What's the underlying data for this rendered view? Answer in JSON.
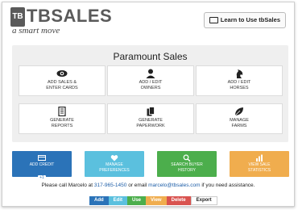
{
  "header": {
    "logo_mark": "TB",
    "logo_text": "TBSALES",
    "tagline": "a smart move",
    "learn_button": "Learn to Use tbSales"
  },
  "panel": {
    "title": "Paramount Sales",
    "tiles": [
      {
        "line1": "ADD SALES &",
        "line2": "ENTER CARDS",
        "icon": "eye-icon"
      },
      {
        "line1": "ADD / EDIT",
        "line2": "OWNERS",
        "icon": "user-icon"
      },
      {
        "line1": "ADD / EDIT",
        "line2": "HORSES",
        "icon": "horse-icon"
      },
      {
        "line1": "GENERATE",
        "line2": "REPORTS",
        "icon": "report-icon"
      },
      {
        "line1": "GENERATE",
        "line2": "PAPERWORK",
        "icon": "paperwork-icon"
      },
      {
        "line1": "MANAGE",
        "line2": "FARMS",
        "icon": "leaf-icon"
      }
    ]
  },
  "actions": [
    {
      "line1": "ADD CREDIT",
      "line2": "",
      "badge": "+1",
      "color": "#2b73b8",
      "icon": "credit-card-icon"
    },
    {
      "line1": "MANAGE",
      "line2": "PREFERENCES",
      "badge": "",
      "color": "#5bc0de",
      "icon": "heart-icon"
    },
    {
      "line1": "SEARCH BUYER",
      "line2": "HISTORY",
      "badge": "",
      "color": "#4cae4c",
      "icon": "search-icon"
    },
    {
      "line1": "VIEW SALE",
      "line2": "STATISTICS",
      "badge": "",
      "color": "#f0ad4e",
      "icon": "statistics-icon"
    }
  ],
  "contact": {
    "prefix": "Please call Marcelo at",
    "phone": "317-965-1450",
    "middle": "or email",
    "email": "marcelo@tbsales.com",
    "suffix": "if you need assistance."
  },
  "bottom_bar": [
    {
      "label": "Add",
      "color": "#2b73b8"
    },
    {
      "label": "Edit",
      "color": "#5bc0de"
    },
    {
      "label": "Use",
      "color": "#4cae4c"
    },
    {
      "label": "View",
      "color": "#f0ad4e"
    },
    {
      "label": "Delete",
      "color": "#d9534f"
    },
    {
      "label": "Export",
      "color": "#ffffff"
    }
  ]
}
